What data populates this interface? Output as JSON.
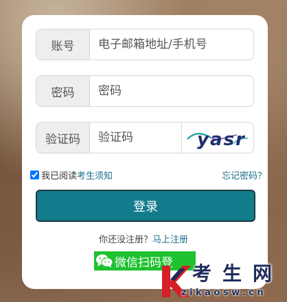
{
  "form": {
    "account": {
      "label": "账号",
      "placeholder": "电子邮箱地址/手机号"
    },
    "password": {
      "label": "密码",
      "placeholder": "密码"
    },
    "captcha": {
      "label": "验证码",
      "placeholder": "验证码",
      "image_text": "yasr"
    },
    "agree": {
      "prefix": "我已阅读",
      "link": "考生须知",
      "checked": true
    },
    "forgot_password": "忘记密码？",
    "login_button": "登录",
    "register": {
      "prompt": "你还没注册？",
      "link": "马上注册"
    },
    "wechat_button": "微信扫码登"
  },
  "watermark": {
    "title": "考生网",
    "domain": "zikaosw.cn"
  },
  "colors": {
    "primary": "#137c8c",
    "link": "#1a6e8c",
    "wechat": "#1ec22f",
    "watermark_red": "#d61f26",
    "watermark_navy": "#1d2c5a"
  }
}
